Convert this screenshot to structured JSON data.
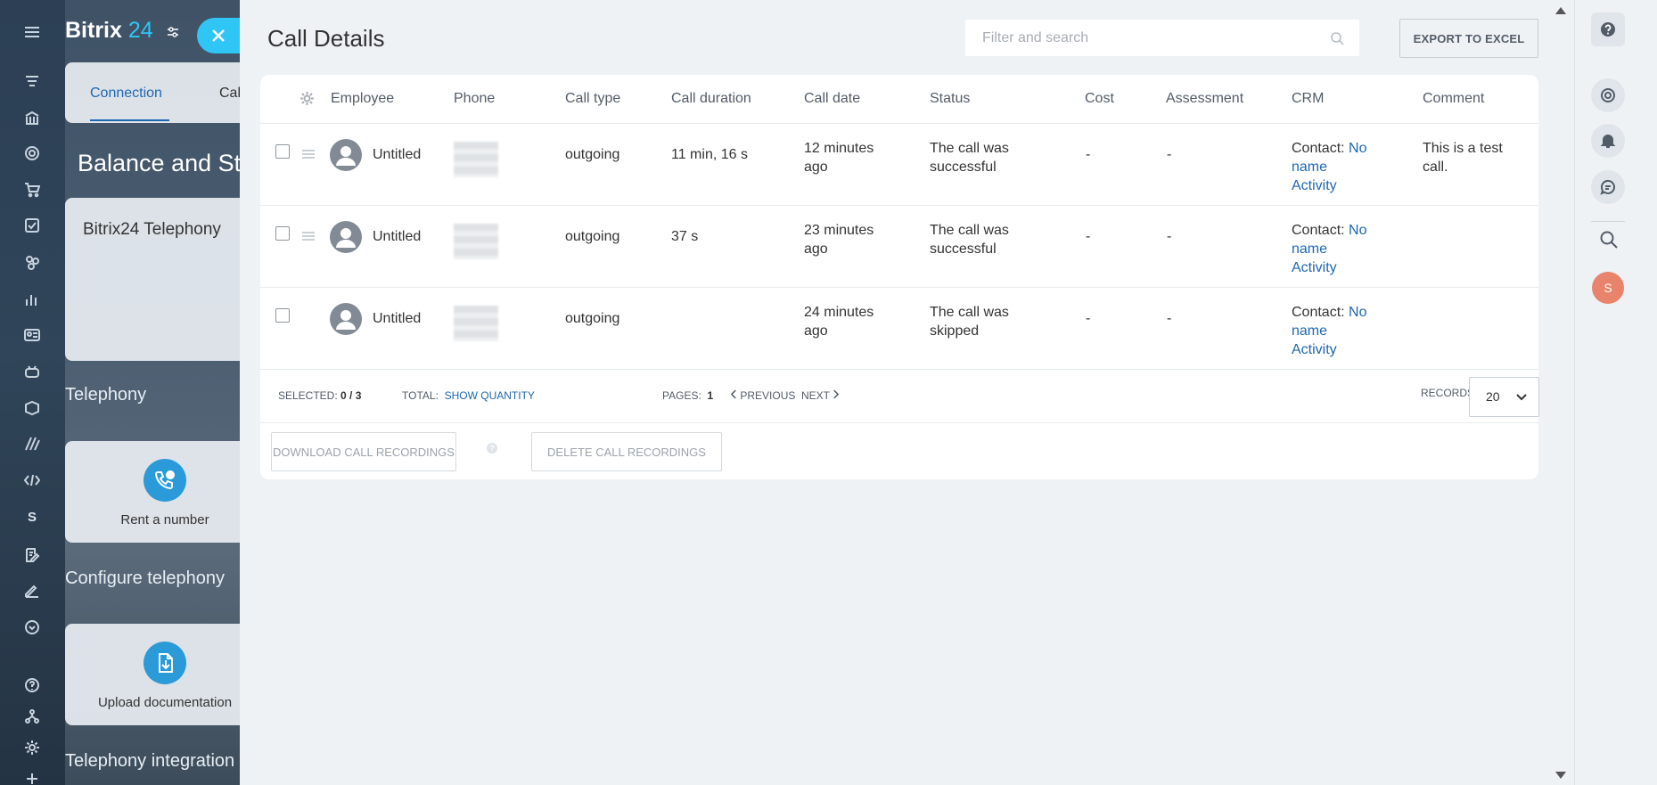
{
  "portal": {
    "logo_name": "Bitrix",
    "logo_number": "24",
    "tabs": [
      {
        "label": "Connection"
      },
      {
        "label": "Cal"
      }
    ],
    "page_title": "Balance and St",
    "telephony_card_title": "Bitrix24 Telephony",
    "sections": [
      {
        "title": "Telephony"
      },
      {
        "title": "Configure telephony"
      },
      {
        "title": "Telephony integration"
      }
    ],
    "tiles": [
      {
        "label": "Rent a number",
        "icon": "phone-rent-icon"
      },
      {
        "label": "Upload documentation",
        "icon": "upload-document-icon"
      }
    ]
  },
  "panel": {
    "title": "Call Details",
    "search_placeholder": "Filter and search",
    "export_label": "EXPORT TO EXCEL"
  },
  "grid": {
    "columns": [
      {
        "label": "Employee"
      },
      {
        "label": "Phone"
      },
      {
        "label": "Call type"
      },
      {
        "label": "Call duration"
      },
      {
        "label": "Call date"
      },
      {
        "label": "Status"
      },
      {
        "label": "Cost"
      },
      {
        "label": "Assessment"
      },
      {
        "label": "CRM"
      },
      {
        "label": "Comment"
      }
    ],
    "rows": [
      {
        "employee": "Untitled",
        "call_type": "outgoing",
        "duration": "11 min, 16 s",
        "date_line1": "12 minutes",
        "date_line2": "ago",
        "status_line1": "The call was",
        "status_line2": "successful",
        "cost": "-",
        "assessment": "-",
        "crm_prefix": "Contact:",
        "crm_link1": "No",
        "crm_link2": "name",
        "crm_link3": "Activity",
        "comment_line1": "This is a test",
        "comment_line2": "call."
      },
      {
        "employee": "Untitled",
        "call_type": "outgoing",
        "duration": "37 s",
        "date_line1": "23 minutes",
        "date_line2": "ago",
        "status_line1": "The call was",
        "status_line2": "successful",
        "cost": "-",
        "assessment": "-",
        "crm_prefix": "Contact:",
        "crm_link1": "No",
        "crm_link2": "name",
        "crm_link3": "Activity",
        "comment_line1": "",
        "comment_line2": ""
      },
      {
        "employee": "Untitled",
        "call_type": "outgoing",
        "duration": "",
        "date_line1": "24 minutes",
        "date_line2": "ago",
        "status_line1": "The call was",
        "status_line2": "skipped",
        "cost": "-",
        "assessment": "-",
        "crm_prefix": "Contact:",
        "crm_link1": "No",
        "crm_link2": "name",
        "crm_link3": "Activity",
        "comment_line1": "",
        "comment_line2": ""
      }
    ],
    "footer": {
      "selected_label": "SELECTED:",
      "selected_value": "0 / 3",
      "total_label": "TOTAL:",
      "total_link": "SHOW QUANTITY",
      "pages_label": "PAGES:",
      "pages_value": "1",
      "previous_label": "PREVIOUS",
      "next_label": "NEXT",
      "records_label": "RECORDS:",
      "records_value": "20"
    },
    "actions": {
      "download_label": "DOWNLOAD CALL RECORDINGS",
      "delete_label": "DELETE CALL RECORDINGS",
      "help_glyph": "?"
    }
  },
  "right_rail": {
    "avatar_initial": "S"
  },
  "left_rail": {
    "s_label": "S"
  },
  "colors": {
    "accent": "#2fc6f6",
    "link": "#2067b0",
    "avatar": "#e8836c"
  }
}
